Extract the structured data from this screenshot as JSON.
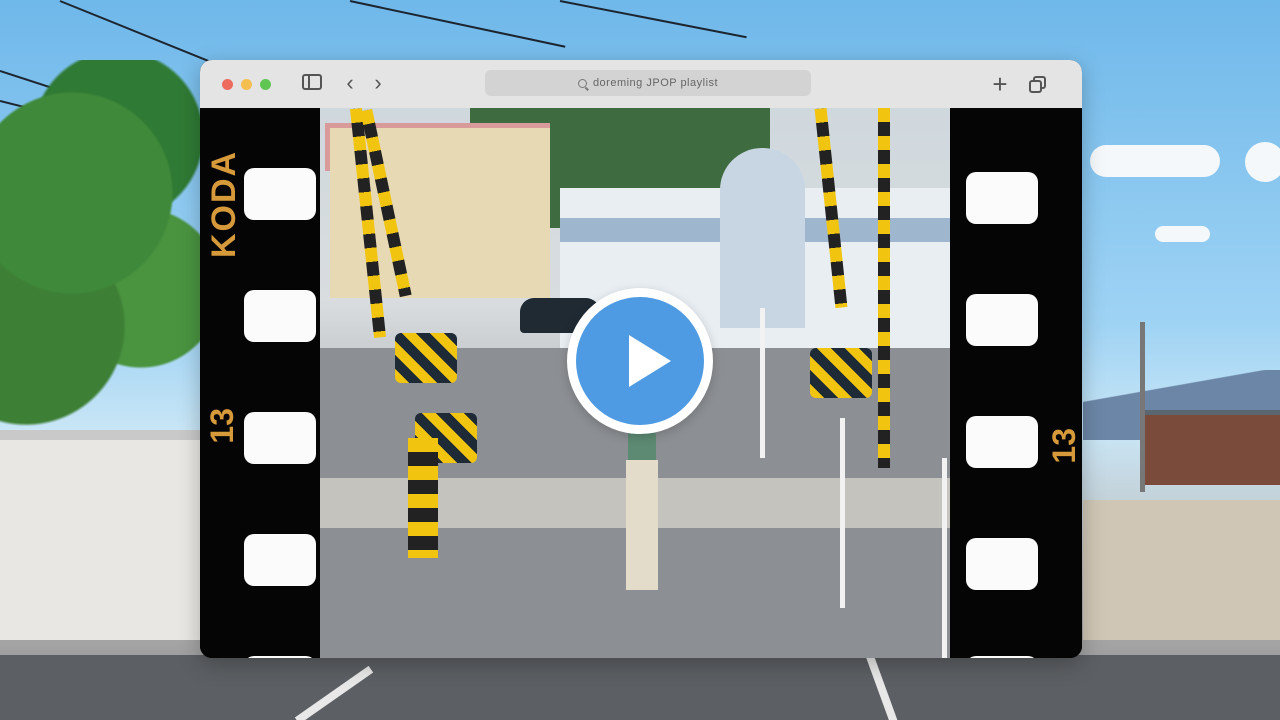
{
  "window": {
    "address_bar": "doreming JPOP playlist"
  },
  "film": {
    "brand": "KODA",
    "frame_number_left": "13",
    "frame_number_right": "13"
  },
  "captions": {
    "left": "doreming",
    "right": "playlist"
  },
  "icons": {
    "traffic_lights": [
      "close-dot",
      "minimize-dot",
      "zoom-dot"
    ],
    "sidebar": "sidebar-icon",
    "back": "chevron-left-icon",
    "forward": "chevron-right-icon",
    "search": "search-icon",
    "new_tab": "plus-icon",
    "tabs": "tabs-overview-icon",
    "play": "play-icon"
  },
  "colors": {
    "play_button": "#4e9be3",
    "film_text": "#d79a3a",
    "close": "#ed6a5e",
    "minimize": "#f5bf4f",
    "zoom": "#61c554"
  }
}
